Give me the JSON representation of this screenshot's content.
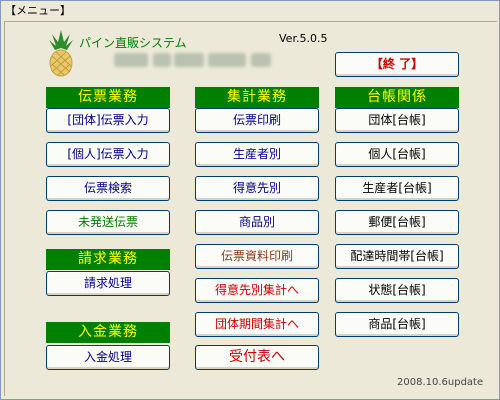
{
  "window": {
    "title": "【メニュー】"
  },
  "header": {
    "app_name": "パイン直販システム",
    "version": "Ver.5.0.5",
    "exit_button": "【終 了】"
  },
  "sections": {
    "slip": "伝票業務",
    "totals": "集計業務",
    "ledger": "台帳関係",
    "billing": "請求業務",
    "payment": "入金業務"
  },
  "slip_buttons": {
    "corp_entry": "[団体]伝票入力",
    "personal_entry": "[個人]伝票入力",
    "search": "伝票検索",
    "unsent": "未発送伝票"
  },
  "billing_buttons": {
    "process": "請求処理"
  },
  "payment_buttons": {
    "process": "入金処理"
  },
  "totals_buttons": {
    "print": "伝票印刷",
    "by_producer": "生産者別",
    "by_customer": "得意先別",
    "by_product": "商品別",
    "material_print": "伝票資料印刷",
    "customer_total": "得意先別集計へ",
    "group_period_total": "団体期間集計へ",
    "reception": "受付表へ"
  },
  "ledger_buttons": {
    "group": "団体[台帳]",
    "personal": "個人[台帳]",
    "producer": "生産者[台帳]",
    "postal": "郵便[台帳]",
    "delivery_time": "配達時間帯[台帳]",
    "status": "状態[台帳]",
    "product": "商品[台帳]"
  },
  "footer": {
    "update": "2008.10.6update"
  }
}
